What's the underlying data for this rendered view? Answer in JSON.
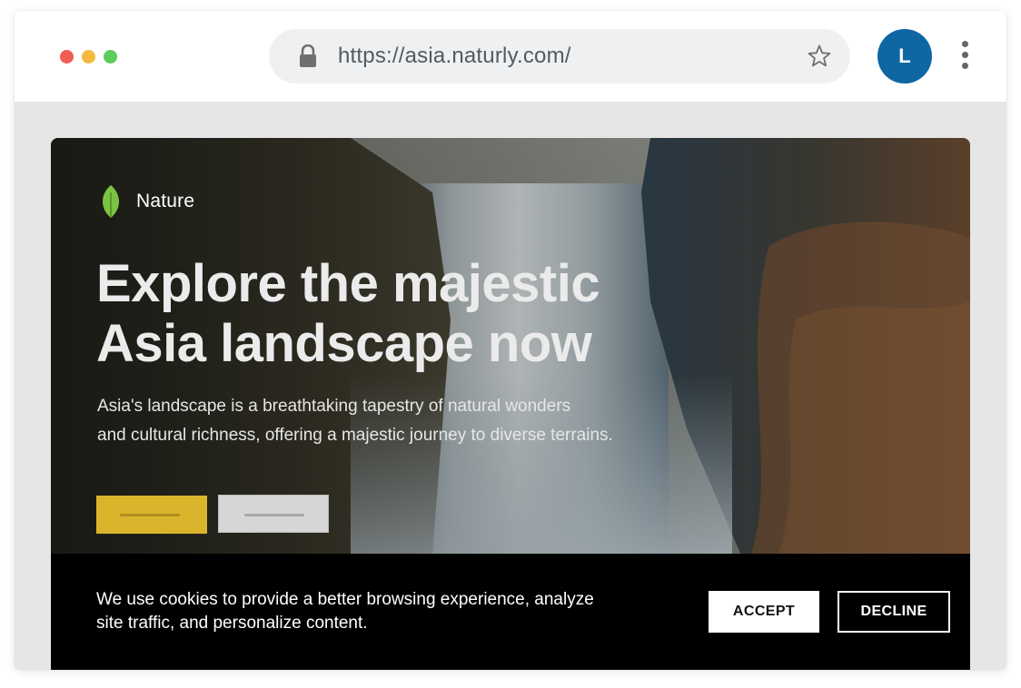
{
  "browser": {
    "url": "https://asia.naturly.com/",
    "avatar_initial": "L",
    "icons": [
      "lock-icon",
      "star-icon",
      "more-vertical-icon"
    ]
  },
  "hero": {
    "brand_name": "Nature",
    "headline_line1": "Explore the majestic",
    "headline_line2": "Asia landscape now",
    "subtext_line1": "Asia's landscape is a breathtaking tapestry of natural wonders",
    "subtext_line2": "and cultural richness, offering a majestic journey to diverse terrains."
  },
  "cookie_banner": {
    "text_line1": "We use cookies to provide a better browsing experience, analyze",
    "text_line2": "site traffic, and personalize content.",
    "accept_label": "ACCEPT",
    "decline_label": "DECLINE"
  },
  "colors": {
    "accent_yellow": "#dab42a",
    "avatar_blue": "#0e66a3",
    "leaf_green": "#7cc243"
  }
}
